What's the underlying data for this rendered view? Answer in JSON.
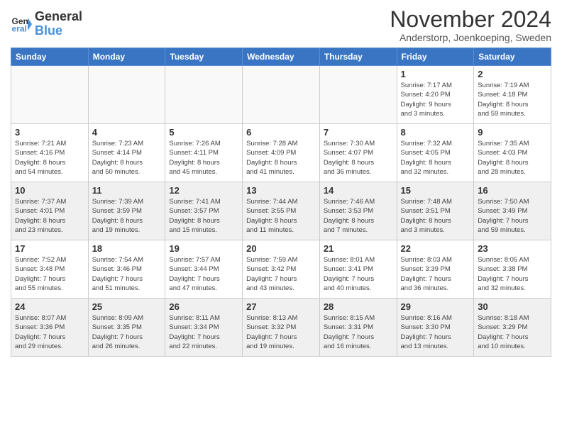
{
  "header": {
    "logo_line1": "General",
    "logo_line2": "Blue",
    "month": "November 2024",
    "location": "Anderstorp, Joenkoeping, Sweden"
  },
  "weekdays": [
    "Sunday",
    "Monday",
    "Tuesday",
    "Wednesday",
    "Thursday",
    "Friday",
    "Saturday"
  ],
  "weeks": [
    [
      {
        "day": "",
        "info": ""
      },
      {
        "day": "",
        "info": ""
      },
      {
        "day": "",
        "info": ""
      },
      {
        "day": "",
        "info": ""
      },
      {
        "day": "",
        "info": ""
      },
      {
        "day": "1",
        "info": "Sunrise: 7:17 AM\nSunset: 4:20 PM\nDaylight: 9 hours\nand 3 minutes."
      },
      {
        "day": "2",
        "info": "Sunrise: 7:19 AM\nSunset: 4:18 PM\nDaylight: 8 hours\nand 59 minutes."
      }
    ],
    [
      {
        "day": "3",
        "info": "Sunrise: 7:21 AM\nSunset: 4:16 PM\nDaylight: 8 hours\nand 54 minutes."
      },
      {
        "day": "4",
        "info": "Sunrise: 7:23 AM\nSunset: 4:14 PM\nDaylight: 8 hours\nand 50 minutes."
      },
      {
        "day": "5",
        "info": "Sunrise: 7:26 AM\nSunset: 4:11 PM\nDaylight: 8 hours\nand 45 minutes."
      },
      {
        "day": "6",
        "info": "Sunrise: 7:28 AM\nSunset: 4:09 PM\nDaylight: 8 hours\nand 41 minutes."
      },
      {
        "day": "7",
        "info": "Sunrise: 7:30 AM\nSunset: 4:07 PM\nDaylight: 8 hours\nand 36 minutes."
      },
      {
        "day": "8",
        "info": "Sunrise: 7:32 AM\nSunset: 4:05 PM\nDaylight: 8 hours\nand 32 minutes."
      },
      {
        "day": "9",
        "info": "Sunrise: 7:35 AM\nSunset: 4:03 PM\nDaylight: 8 hours\nand 28 minutes."
      }
    ],
    [
      {
        "day": "10",
        "info": "Sunrise: 7:37 AM\nSunset: 4:01 PM\nDaylight: 8 hours\nand 23 minutes."
      },
      {
        "day": "11",
        "info": "Sunrise: 7:39 AM\nSunset: 3:59 PM\nDaylight: 8 hours\nand 19 minutes."
      },
      {
        "day": "12",
        "info": "Sunrise: 7:41 AM\nSunset: 3:57 PM\nDaylight: 8 hours\nand 15 minutes."
      },
      {
        "day": "13",
        "info": "Sunrise: 7:44 AM\nSunset: 3:55 PM\nDaylight: 8 hours\nand 11 minutes."
      },
      {
        "day": "14",
        "info": "Sunrise: 7:46 AM\nSunset: 3:53 PM\nDaylight: 8 hours\nand 7 minutes."
      },
      {
        "day": "15",
        "info": "Sunrise: 7:48 AM\nSunset: 3:51 PM\nDaylight: 8 hours\nand 3 minutes."
      },
      {
        "day": "16",
        "info": "Sunrise: 7:50 AM\nSunset: 3:49 PM\nDaylight: 7 hours\nand 59 minutes."
      }
    ],
    [
      {
        "day": "17",
        "info": "Sunrise: 7:52 AM\nSunset: 3:48 PM\nDaylight: 7 hours\nand 55 minutes."
      },
      {
        "day": "18",
        "info": "Sunrise: 7:54 AM\nSunset: 3:46 PM\nDaylight: 7 hours\nand 51 minutes."
      },
      {
        "day": "19",
        "info": "Sunrise: 7:57 AM\nSunset: 3:44 PM\nDaylight: 7 hours\nand 47 minutes."
      },
      {
        "day": "20",
        "info": "Sunrise: 7:59 AM\nSunset: 3:42 PM\nDaylight: 7 hours\nand 43 minutes."
      },
      {
        "day": "21",
        "info": "Sunrise: 8:01 AM\nSunset: 3:41 PM\nDaylight: 7 hours\nand 40 minutes."
      },
      {
        "day": "22",
        "info": "Sunrise: 8:03 AM\nSunset: 3:39 PM\nDaylight: 7 hours\nand 36 minutes."
      },
      {
        "day": "23",
        "info": "Sunrise: 8:05 AM\nSunset: 3:38 PM\nDaylight: 7 hours\nand 32 minutes."
      }
    ],
    [
      {
        "day": "24",
        "info": "Sunrise: 8:07 AM\nSunset: 3:36 PM\nDaylight: 7 hours\nand 29 minutes."
      },
      {
        "day": "25",
        "info": "Sunrise: 8:09 AM\nSunset: 3:35 PM\nDaylight: 7 hours\nand 26 minutes."
      },
      {
        "day": "26",
        "info": "Sunrise: 8:11 AM\nSunset: 3:34 PM\nDaylight: 7 hours\nand 22 minutes."
      },
      {
        "day": "27",
        "info": "Sunrise: 8:13 AM\nSunset: 3:32 PM\nDaylight: 7 hours\nand 19 minutes."
      },
      {
        "day": "28",
        "info": "Sunrise: 8:15 AM\nSunset: 3:31 PM\nDaylight: 7 hours\nand 16 minutes."
      },
      {
        "day": "29",
        "info": "Sunrise: 8:16 AM\nSunset: 3:30 PM\nDaylight: 7 hours\nand 13 minutes."
      },
      {
        "day": "30",
        "info": "Sunrise: 8:18 AM\nSunset: 3:29 PM\nDaylight: 7 hours\nand 10 minutes."
      }
    ]
  ]
}
